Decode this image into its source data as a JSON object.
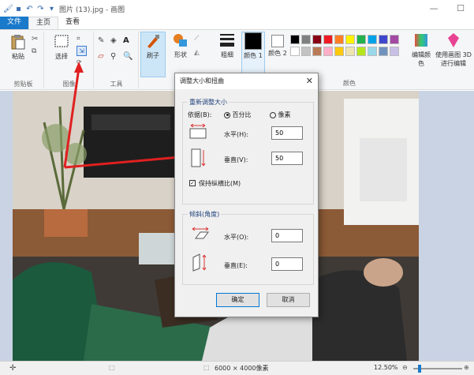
{
  "window": {
    "title": "图片 (13).jpg - 画图",
    "min": "—",
    "max": "☐"
  },
  "tabs": {
    "file": "文件",
    "home": "主页",
    "view": "查看"
  },
  "ribbon": {
    "clipboard": {
      "paste": "粘贴",
      "label": "剪贴板"
    },
    "image": {
      "select": "选择",
      "label": "图像"
    },
    "tools": {
      "label": "工具"
    },
    "brush": "刷子",
    "shapes": "形状",
    "size": "粗细",
    "color1": "颜色 1",
    "color2": "颜色 2",
    "colors_label": "颜色",
    "edit_colors": "编辑颜色",
    "paint3d": "使用画图 3D 进行编辑",
    "palette": [
      "#000000",
      "#7f7f7f",
      "#880015",
      "#ed1c24",
      "#ff7f27",
      "#fff200",
      "#22b14c",
      "#00a2e8",
      "#3f48cc",
      "#a349a4",
      "#ffffff",
      "#c3c3c3",
      "#b97a57",
      "#ffaec9",
      "#ffc90e",
      "#efe4b0",
      "#b5e61d",
      "#99d9ea",
      "#7092be",
      "#c8bfe7"
    ]
  },
  "dialog": {
    "title": "调整大小和扭曲",
    "close": "✕",
    "resize_legend": "重新调整大小",
    "by_label": "依据(B):",
    "percent": "百分比",
    "pixels": "像素",
    "horizontal": "水平(H):",
    "vertical": "垂直(V):",
    "h_value": "50",
    "v_value": "50",
    "keep_ratio": "保持纵横比(M)",
    "skew_legend": "倾斜(角度)",
    "skew_h": "水平(O):",
    "skew_v": "垂直(E):",
    "skew_h_value": "0",
    "skew_v_value": "0",
    "ok": "确定",
    "cancel": "取消"
  },
  "status": {
    "size": "6000 × 4000像素",
    "zoom": "12.50%"
  }
}
